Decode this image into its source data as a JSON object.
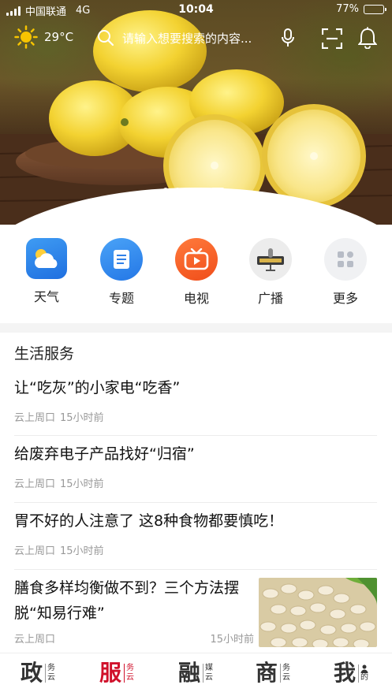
{
  "status_bar": {
    "carrier": "中国联通",
    "network": "4G",
    "time": "10:04",
    "battery": "77%",
    "battery_level": 0.77
  },
  "header": {
    "temperature": "29°C",
    "weather_icon": "sun-icon",
    "search_placeholder": "请输入想要搜索的内容...",
    "icons": [
      "search-icon",
      "mic-icon",
      "scan-icon",
      "bell-icon"
    ]
  },
  "carousel": {
    "slide_count": 5,
    "active_index": 4
  },
  "quick_links": [
    {
      "label": "天气",
      "icon": "weather-icon"
    },
    {
      "label": "专题",
      "icon": "document-icon"
    },
    {
      "label": "电视",
      "icon": "tv-icon"
    },
    {
      "label": "广播",
      "icon": "radio-icon"
    },
    {
      "label": "更多",
      "icon": "more-grid-icon"
    }
  ],
  "section_title": "生活服务",
  "news": [
    {
      "title": "让“吃灰”的小家电“吃香”",
      "source": "云上周口",
      "time": "15小时前"
    },
    {
      "title": "给废弃电子产品找好“归宿”",
      "source": "云上周口",
      "time": "15小时前"
    },
    {
      "title": "胃不好的人注意了 这8种食物都要慎吃！",
      "source": "云上周口",
      "time": "15小时前"
    },
    {
      "title": "膳食多样均衡做不到？三个方法摆脱“知易行难”",
      "source": "云上周口",
      "time": "15小时前",
      "has_thumbnail": true
    }
  ],
  "tabs": [
    {
      "big": "政",
      "small1": "务",
      "small2": "云",
      "active": false
    },
    {
      "big": "服",
      "small1": "务",
      "small2": "云",
      "active": true
    },
    {
      "big": "融",
      "small1": "媒",
      "small2": "云",
      "active": false
    },
    {
      "big": "商",
      "small1": "务",
      "small2": "云",
      "active": false
    },
    {
      "big": "我",
      "small1": "",
      "small2": "的",
      "active": false
    }
  ],
  "colors": {
    "accent": "#d0112b",
    "meta_text": "#999999"
  }
}
